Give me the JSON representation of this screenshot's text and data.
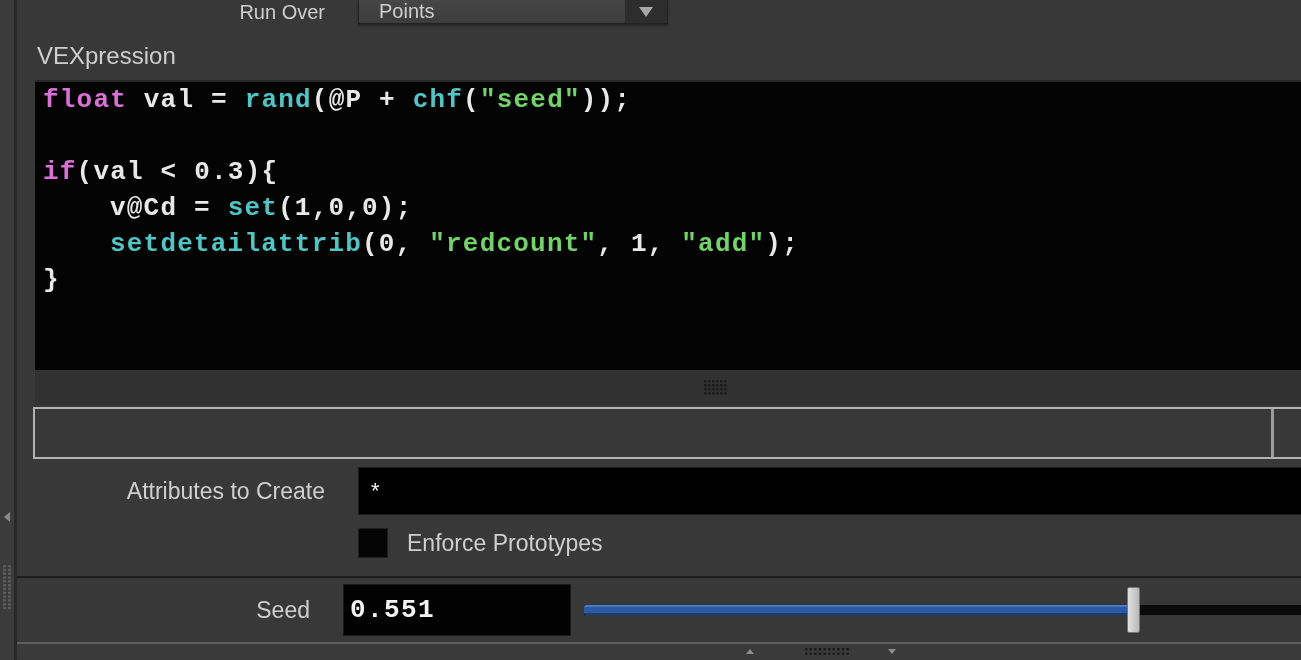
{
  "run_over": {
    "label": "Run Over",
    "value": "Points"
  },
  "vexpression": {
    "label": "VEXpression",
    "code_blocks": [
      [
        {
          "tokens": [
            {
              "kind": "keyword",
              "text": "float"
            },
            {
              "kind": "plain",
              "text": " val = "
            },
            {
              "kind": "function",
              "text": "rand"
            },
            {
              "kind": "plain",
              "text": "(@P + "
            },
            {
              "kind": "function",
              "text": "chf"
            },
            {
              "kind": "plain",
              "text": "("
            },
            {
              "kind": "string",
              "text": "\"seed\""
            },
            {
              "kind": "plain",
              "text": "));"
            }
          ]
        }
      ],
      [
        {
          "tokens": [
            {
              "kind": "keyword",
              "text": "if"
            },
            {
              "kind": "plain",
              "text": "(val < 0.3){"
            }
          ],
          "children": [
            {
              "tokens": [
                {
                  "kind": "plain",
                  "text": "v@Cd = "
                },
                {
                  "kind": "function",
                  "text": "set"
                },
                {
                  "kind": "plain",
                  "text": "(1,0,0);"
                }
              ]
            },
            {
              "tokens": [
                {
                  "kind": "function",
                  "text": "setdetailattrib"
                },
                {
                  "kind": "plain",
                  "text": "(0, "
                },
                {
                  "kind": "string",
                  "text": "\"redcount\""
                },
                {
                  "kind": "plain",
                  "text": ", 1, "
                },
                {
                  "kind": "string",
                  "text": "\"add\""
                },
                {
                  "kind": "plain",
                  "text": ");"
                }
              ]
            }
          ]
        },
        {
          "tokens": [
            {
              "kind": "plain",
              "text": "}"
            }
          ]
        }
      ]
    ]
  },
  "attributes_to_create": {
    "label": "Attributes to Create",
    "value": "*"
  },
  "enforce_prototypes": {
    "label": "Enforce Prototypes",
    "checked": false
  },
  "seed": {
    "label": "Seed",
    "value": "0.551",
    "level": 0.766
  }
}
